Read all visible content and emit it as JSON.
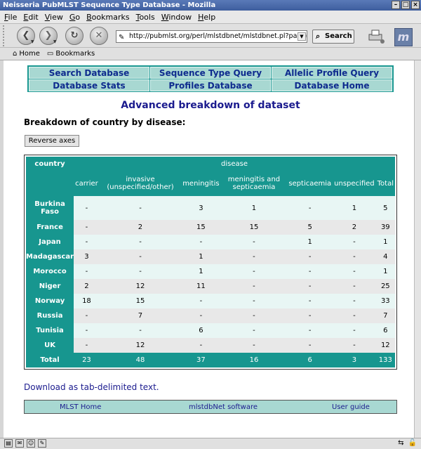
{
  "window": {
    "title": "Neisseria PubMLST Sequence Type Database - Mozilla"
  },
  "menu": {
    "items": [
      {
        "first": "F",
        "rest": "ile"
      },
      {
        "first": "E",
        "rest": "dit"
      },
      {
        "first": "V",
        "rest": "iew"
      },
      {
        "first": "G",
        "rest": "o"
      },
      {
        "first": "B",
        "rest": "ookmarks"
      },
      {
        "first": "T",
        "rest": "ools"
      },
      {
        "first": "W",
        "rest": "indow"
      },
      {
        "first": "H",
        "rest": "elp"
      }
    ]
  },
  "toolbar": {
    "url": "http://pubmlst.org/perl/mlstdbnet/mlstdbnet.pl?page=q",
    "search_label": "Search",
    "icons": [
      "back-icon",
      "forward-icon",
      "reload-icon",
      "stop-icon",
      "print-icon",
      "mozilla-logo"
    ]
  },
  "personal": {
    "home_label": "Home",
    "bookmarks_label": "Bookmarks"
  },
  "nav": {
    "search_database": "Search Database",
    "sequence_type_query": "Sequence Type Query",
    "allelic_profile_query": "Allelic Profile Query",
    "database_stats": "Database Stats",
    "profiles_database": "Profiles Database",
    "database_home": "Database Home"
  },
  "page": {
    "heading": "Advanced breakdown of dataset",
    "subheading": "Breakdown of country by disease:",
    "reverse_axes_label": "Reverse axes",
    "download_link": "Download as tab-delimited text."
  },
  "table": {
    "row_axis_label": "country",
    "col_axis_label": "disease",
    "columns": [
      "carrier",
      "invasive (unspecified/other)",
      "meningitis",
      "meningitis and septicaemia",
      "septicaemia",
      "unspecified",
      "Total"
    ],
    "rows": [
      {
        "label": "Burkina Faso",
        "values": [
          "-",
          "-",
          "3",
          "1",
          "-",
          "1",
          "5"
        ]
      },
      {
        "label": "France",
        "values": [
          "-",
          "2",
          "15",
          "15",
          "5",
          "2",
          "39"
        ]
      },
      {
        "label": "Japan",
        "values": [
          "-",
          "-",
          "-",
          "-",
          "1",
          "-",
          "1"
        ]
      },
      {
        "label": "Madagascar",
        "values": [
          "3",
          "-",
          "1",
          "-",
          "-",
          "-",
          "4"
        ]
      },
      {
        "label": "Morocco",
        "values": [
          "-",
          "-",
          "1",
          "-",
          "-",
          "-",
          "1"
        ]
      },
      {
        "label": "Niger",
        "values": [
          "2",
          "12",
          "11",
          "-",
          "-",
          "-",
          "25"
        ]
      },
      {
        "label": "Norway",
        "values": [
          "18",
          "15",
          "-",
          "-",
          "-",
          "-",
          "33"
        ]
      },
      {
        "label": "Russia",
        "values": [
          "-",
          "7",
          "-",
          "-",
          "-",
          "-",
          "7"
        ]
      },
      {
        "label": "Tunisia",
        "values": [
          "-",
          "-",
          "6",
          "-",
          "-",
          "-",
          "6"
        ]
      },
      {
        "label": "UK",
        "values": [
          "-",
          "12",
          "-",
          "-",
          "-",
          "-",
          "12"
        ]
      }
    ],
    "total_row": {
      "label": "Total",
      "values": [
        "23",
        "48",
        "37",
        "16",
        "6",
        "3",
        "133"
      ]
    }
  },
  "footer": {
    "mlst_home": "MLST Home",
    "mlstdbnet_software": "mlstdbNet software",
    "user_guide": "User guide"
  },
  "colors": {
    "accent_teal": "#17968f",
    "nav_cell_bg": "#a8d8d2",
    "link_blue": "#1b1b8e"
  }
}
